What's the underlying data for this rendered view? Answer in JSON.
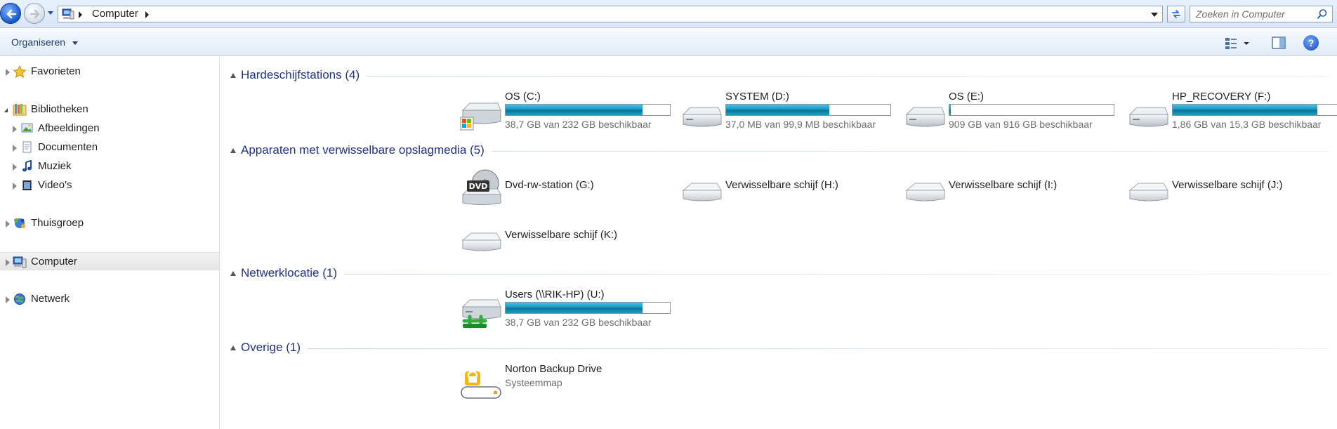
{
  "window": {
    "address": {
      "crumbs": [
        "Computer"
      ]
    },
    "search": {
      "placeholder": "Zoeken in Computer"
    }
  },
  "toolbar": {
    "organise_label": "Organiseren",
    "help_label": "?"
  },
  "nav": {
    "items": [
      {
        "label": "Favorieten",
        "icon": "star-icon"
      },
      {
        "label": "Bibliotheken",
        "icon": "libraries-icon"
      },
      {
        "label": "Afbeeldingen",
        "icon": "pictures-icon"
      },
      {
        "label": "Documenten",
        "icon": "documents-icon"
      },
      {
        "label": "Muziek",
        "icon": "music-icon"
      },
      {
        "label": "Video's",
        "icon": "videos-icon"
      },
      {
        "label": "Thuisgroep",
        "icon": "homegroup-icon"
      },
      {
        "label": "Computer",
        "icon": "computer-icon"
      },
      {
        "label": "Netwerk",
        "icon": "network-icon"
      }
    ]
  },
  "groups": [
    {
      "title": "Hardeschijfstations (4)",
      "items": [
        {
          "name": "OS (C:)",
          "info": "38,7 GB van 232 GB beschikbaar",
          "used": 0.833,
          "icon": "windows-drive-icon"
        },
        {
          "name": "SYSTEM (D:)",
          "info": "37,0 MB van 99,9 MB beschikbaar",
          "used": 0.63,
          "icon": "hard-drive-icon"
        },
        {
          "name": "OS (E:)",
          "info": "909 GB van 916 GB beschikbaar",
          "used": 0.008,
          "icon": "hard-drive-icon"
        },
        {
          "name": "HP_RECOVERY (F:)",
          "info": "1,86 GB van 15,3 GB beschikbaar",
          "used": 0.878,
          "icon": "hard-drive-icon"
        }
      ]
    },
    {
      "title": "Apparaten met verwisselbare opslagmedia (5)",
      "items": [
        {
          "name": "Dvd-rw-station (G:)",
          "icon": "dvd-drive-icon",
          "dvd_label": "DVD"
        },
        {
          "name": "Verwisselbare schijf (H:)",
          "icon": "removable-drive-icon"
        },
        {
          "name": "Verwisselbare schijf (I:)",
          "icon": "removable-drive-icon"
        },
        {
          "name": "Verwisselbare schijf (J:)",
          "icon": "removable-drive-icon"
        },
        {
          "name": "Verwisselbare schijf (K:)",
          "icon": "removable-drive-icon"
        }
      ]
    },
    {
      "title": "Netwerklocatie (1)",
      "items": [
        {
          "name": "Users (\\\\RIK-HP) (U:)",
          "info": "38,7 GB van 232 GB beschikbaar",
          "used": 0.833,
          "icon": "network-drive-icon"
        }
      ]
    },
    {
      "title": "Overige (1)",
      "items": [
        {
          "name": "Norton Backup Drive",
          "info": "Systeemmap",
          "icon": "norton-backup-icon"
        }
      ]
    }
  ]
}
